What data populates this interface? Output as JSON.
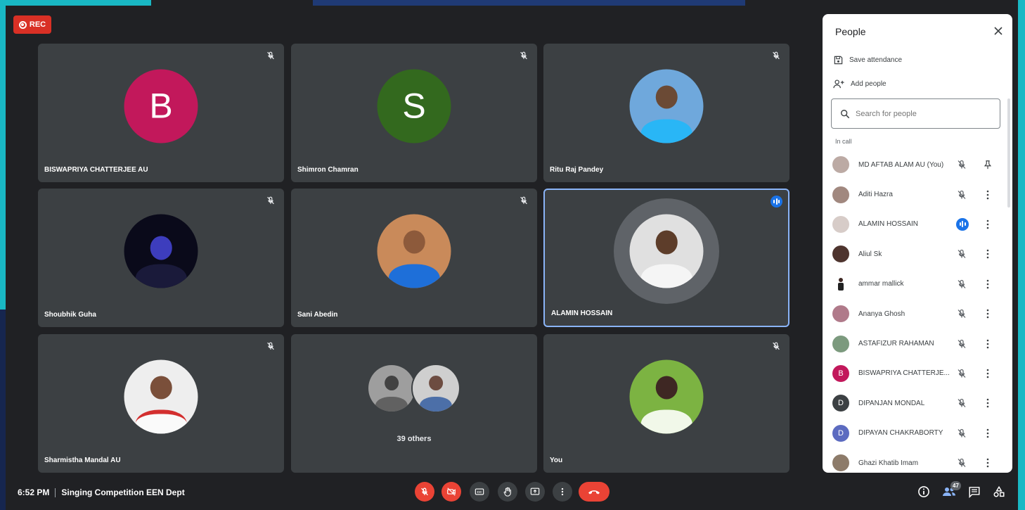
{
  "recording": {
    "label": "REC"
  },
  "tiles": [
    {
      "name": "BISWAPRIYA CHATTERJEE AU",
      "initial": "B",
      "color": "#c2185b",
      "muted": true
    },
    {
      "name": "Shimron Chamran",
      "initial": "S",
      "color": "#33691e",
      "muted": true
    },
    {
      "name": "Ritu Raj Pandey",
      "photo": "man-blue-shirt",
      "muted": true
    },
    {
      "name": "Shoubhik Guha",
      "photo": "dark-portrait",
      "muted": true
    },
    {
      "name": "Sani Abedin",
      "photo": "man-blue-tshirt",
      "muted": true
    },
    {
      "name": "ALAMIN HOSSAIN",
      "photo": "man-white-shirt",
      "speaking": true
    },
    {
      "name": "Sharmistha Mandal AU",
      "photo": "woman-red-white",
      "muted": true
    },
    {
      "name": "39 others",
      "photo": "group"
    },
    {
      "name": "You",
      "photo": "man-green-bg",
      "muted": true
    }
  ],
  "bottom": {
    "time": "6:52 PM",
    "meeting_title": "Singing Competition EEN Dept",
    "controls": [
      "mic-off-icon",
      "camera-off-icon",
      "captions-icon",
      "raise-hand-icon",
      "present-icon",
      "more-options-icon",
      "end-call-icon"
    ],
    "right_controls": [
      "info-icon",
      "people-icon",
      "chat-icon",
      "activities-icon"
    ],
    "people_count": "47"
  },
  "panel": {
    "title": "People",
    "save_attendance": "Save attendance",
    "add_people": "Add people",
    "search_placeholder": "Search for people",
    "section_label": "In call",
    "people": [
      {
        "name": "MD AFTAB ALAM AU (You)",
        "status": "muted",
        "action": "pin"
      },
      {
        "name": "Aditi Hazra",
        "status": "muted",
        "action": "more"
      },
      {
        "name": "ALAMIN HOSSAIN",
        "status": "speaking",
        "action": "more"
      },
      {
        "name": "Aliul Sk",
        "status": "muted",
        "action": "more"
      },
      {
        "name": "ammar mallick",
        "status": "muted",
        "action": "more"
      },
      {
        "name": "Ananya Ghosh",
        "status": "muted",
        "action": "more"
      },
      {
        "name": "ASTAFIZUR RAHAMAN",
        "status": "muted",
        "action": "more"
      },
      {
        "name": "BISWAPRIYA CHATTERJE...",
        "initial": "B",
        "color": "#c2185b",
        "status": "muted",
        "action": "more"
      },
      {
        "name": "DIPANJAN MONDAL",
        "initial": "D",
        "color": "#3c4043",
        "status": "muted",
        "action": "more"
      },
      {
        "name": "DIPAYAN CHAKRABORTY",
        "initial": "D",
        "color": "#5c6bc0",
        "status": "muted",
        "action": "more"
      },
      {
        "name": "Ghazi Khatib Imam",
        "status": "muted",
        "action": "more"
      }
    ]
  },
  "colors": {
    "background": "#202124",
    "tile": "#3c4043",
    "accent_blue": "#1a73e8",
    "red": "#ea4335",
    "active_border": "#8ab4f8"
  }
}
